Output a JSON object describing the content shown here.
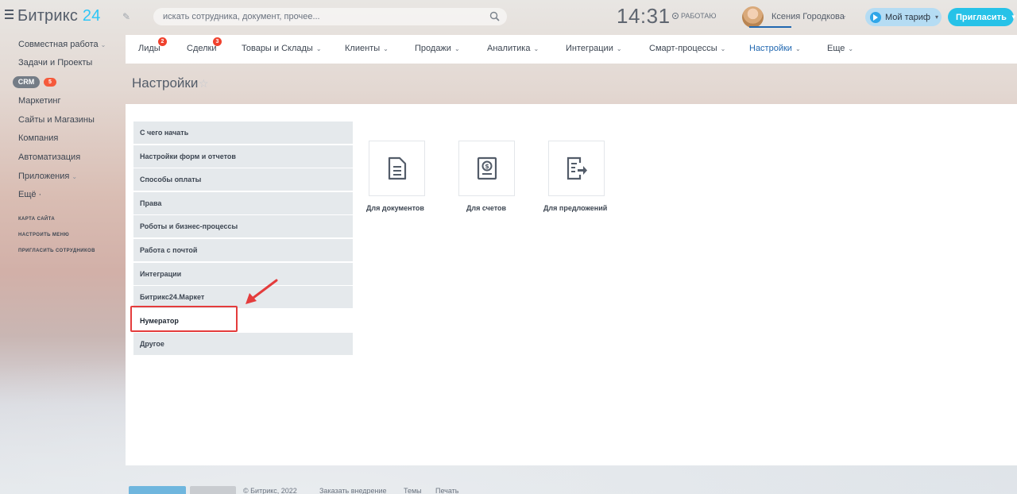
{
  "header": {
    "logo_main": "Битрикс",
    "logo_num": "24",
    "search_placeholder": "искать сотрудника, документ, прочее...",
    "clock": "14:31",
    "status": "РАБОТАЮ",
    "user_name": "Ксения Городкова",
    "tariff_label": "Мой тариф",
    "invite_label": "Пригласить"
  },
  "sidebar": {
    "items": [
      {
        "label": "Совместная работа"
      },
      {
        "label": "Задачи и Проекты"
      },
      {
        "label": "CRM",
        "badge": "5"
      },
      {
        "label": "Маркетинг"
      },
      {
        "label": "Сайты и Магазины"
      },
      {
        "label": "Компания"
      },
      {
        "label": "Автоматизация"
      },
      {
        "label": "Приложения"
      },
      {
        "label": "Ещё ·"
      }
    ],
    "links": [
      "КАРТА САЙТА",
      "НАСТРОИТЬ МЕНЮ",
      "ПРИГЛАСИТЬ СОТРУДНИКОВ"
    ]
  },
  "tabs": [
    {
      "label": "Лиды",
      "badge": "2"
    },
    {
      "label": "Сделки",
      "badge": "3"
    },
    {
      "label": "Товары и Склады"
    },
    {
      "label": "Клиенты"
    },
    {
      "label": "Продажи"
    },
    {
      "label": "Аналитика"
    },
    {
      "label": "Интеграции"
    },
    {
      "label": "Смарт-процессы"
    },
    {
      "label": "Настройки",
      "active": true
    },
    {
      "label": "Еще"
    }
  ],
  "page": {
    "title": "Настройки"
  },
  "settings_menu": [
    "С чего начать",
    "Настройки форм и отчетов",
    "Способы оплаты",
    "Права",
    "Роботы и бизнес-процессы",
    "Работа с почтой",
    "Интеграции",
    "Битрикс24.Маркет",
    "Нумератор",
    "Другое"
  ],
  "selected_menu": "Нумератор",
  "cards": [
    {
      "label": "Для документов",
      "icon": "document-icon"
    },
    {
      "label": "Для счетов",
      "icon": "invoice-icon"
    },
    {
      "label": "Для предложений",
      "icon": "quote-icon"
    }
  ],
  "footer": {
    "year_text": "© Битрикс, 2022",
    "links": [
      "Заказать внедрение",
      "Темы",
      "Печать"
    ]
  },
  "colors": {
    "accent": "#2067b0",
    "invite": "#26c2e8",
    "badge": "#f0412d",
    "annotation": "#e43c3c"
  }
}
